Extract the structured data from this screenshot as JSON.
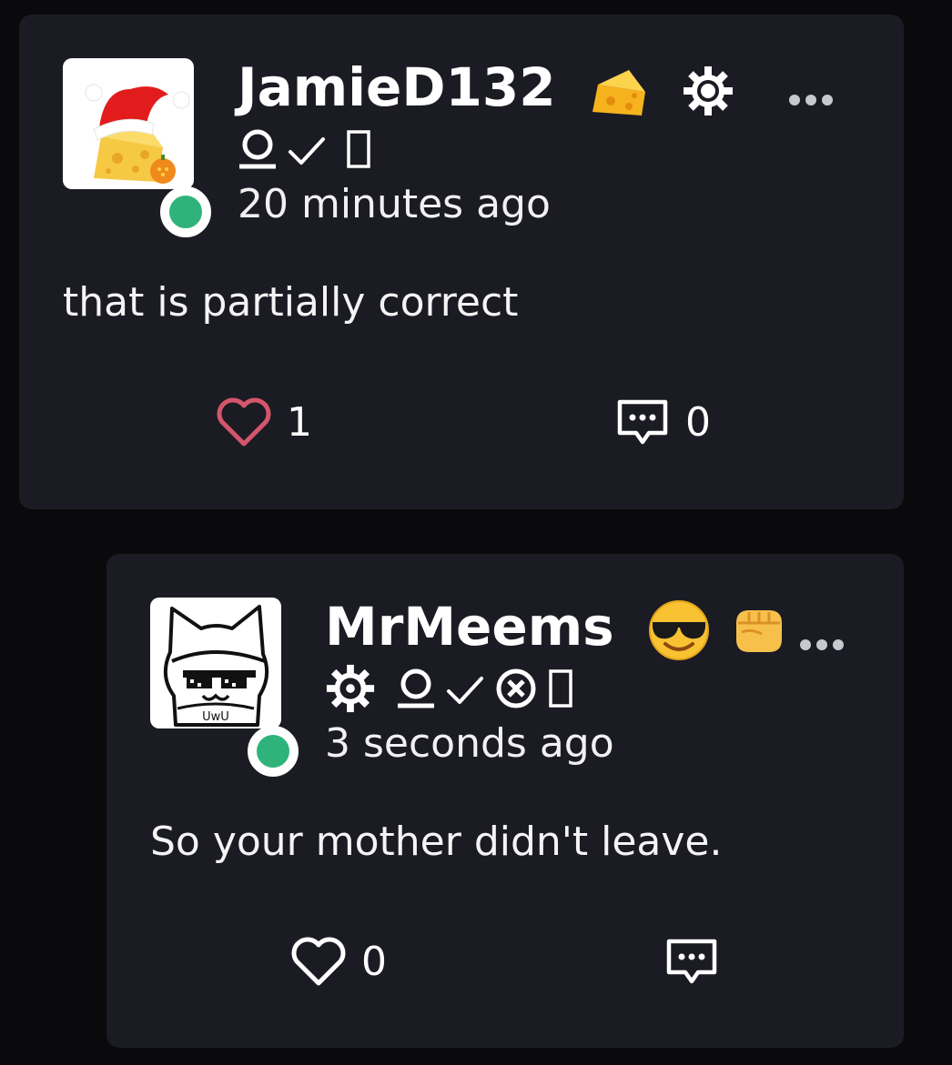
{
  "posts": [
    {
      "username": "JamieD132",
      "badges": [
        "cheese-emoji",
        "gear-icon",
        "person-icon",
        "check-icon",
        "box-icon"
      ],
      "timestamp": "20 minutes ago",
      "text": "that is partially correct",
      "likes": "1",
      "comments": "0",
      "liked": true,
      "online": true
    },
    {
      "username": "MrMeems",
      "badges": [
        "sunglasses-emoji",
        "fist-emoji",
        "gear-icon",
        "person-icon",
        "check-icon",
        "x-circle-icon",
        "box-icon"
      ],
      "timestamp": "3 seconds ago",
      "text": "So your mother didn't leave.",
      "likes": "0",
      "comments": "",
      "liked": false,
      "online": true,
      "avatar_caption": "UwU"
    }
  ],
  "colors": {
    "background": "#0a0a0d",
    "card": "#1b1b24",
    "online": "#2fb37a",
    "liked_heart": "#d4566b"
  }
}
